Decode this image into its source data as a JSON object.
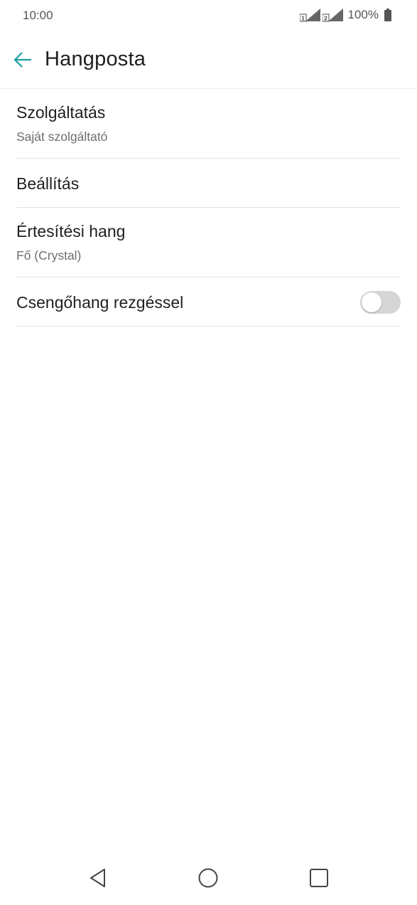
{
  "status_bar": {
    "time": "10:00",
    "battery_percent": "100%",
    "sim1_label": "1",
    "sim2_label": "2",
    "icons": [
      "signal-sim1-icon",
      "signal-sim2-icon",
      "battery-icon"
    ]
  },
  "app_bar": {
    "title": "Hangposta",
    "back_icon": "back-arrow-icon"
  },
  "settings": {
    "items": [
      {
        "title": "Szolgáltatás",
        "subtitle": "Saját szolgáltató"
      },
      {
        "title": "Beállítás"
      },
      {
        "title": "Értesítési hang",
        "subtitle": "Fő (Crystal)"
      },
      {
        "title": "Csengőhang rezgéssel",
        "toggle_state": "off"
      }
    ]
  },
  "nav_bar": {
    "icons": [
      "back-triangle-icon",
      "home-circle-icon",
      "recents-square-icon"
    ]
  },
  "colors": {
    "accent": "#1a9fa5",
    "toggle_track_off": "#d6d6d6",
    "divider": "#e4e4e4",
    "text_primary": "#1f1f1f",
    "text_secondary": "#6e6e6e"
  }
}
